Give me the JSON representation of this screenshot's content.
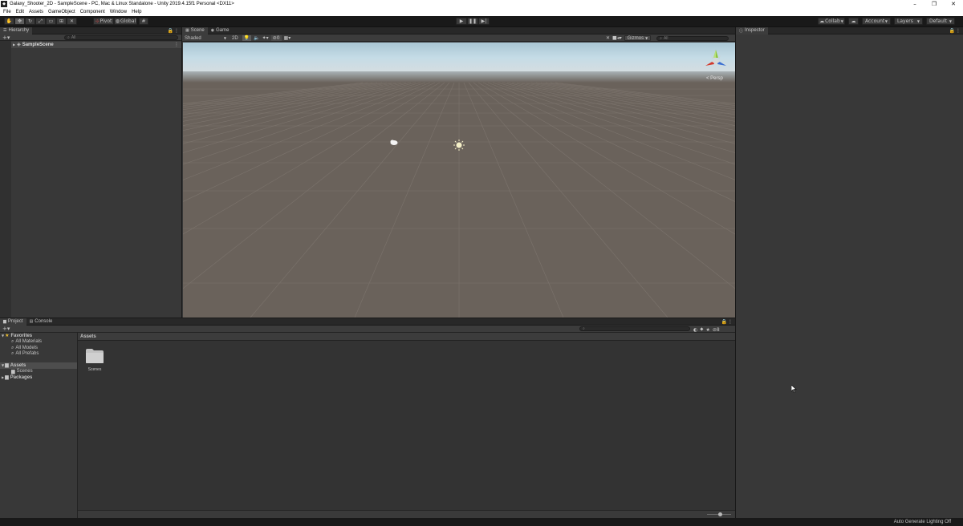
{
  "window": {
    "title": "Galaxy_Shooter_2D - SampleScene - PC, Mac & Linux Standalone - Unity 2019.4.15f1 Personal <DX11>",
    "minimize": "–",
    "restore": "❐",
    "close": "✕"
  },
  "menu": [
    "File",
    "Edit",
    "Assets",
    "GameObject",
    "Component",
    "Window",
    "Help"
  ],
  "toolbar": {
    "pivot_label": "Pivot",
    "global_label": "Global",
    "collab_label": "Collab",
    "account_label": "Account",
    "layers_label": "Layers",
    "layout_label": "Default"
  },
  "hierarchy": {
    "tab_label": "Hierarchy",
    "search_placeholder": "All",
    "scene_name": "SampleScene"
  },
  "scene_view": {
    "tabs": [
      "Scene",
      "Game"
    ],
    "shading_mode": "Shaded",
    "mode_2d_label": "2D",
    "hidden_count": "0",
    "gizmos_label": "Gizmos",
    "search_placeholder": "All",
    "projection_label": "< Persp"
  },
  "inspector": {
    "tab_label": "Inspector"
  },
  "project": {
    "tabs": [
      "Project",
      "Console"
    ],
    "favorites_label": "Favorites",
    "favorites": [
      "All Materials",
      "All Models",
      "All Prefabs"
    ],
    "assets_label": "Assets",
    "assets_children": [
      "Scenes"
    ],
    "packages_label": "Packages",
    "breadcrumb": "Assets",
    "folder_items": [
      "Scenes"
    ],
    "hidden_packages_count": "8"
  },
  "statusbar": {
    "text": "Auto Generate Lighting Off"
  },
  "colors": {
    "editor_bg": "#191919",
    "panel_bg": "#383838",
    "ground": "#6a625b",
    "sky_top": "#c5dce6",
    "gizmo_y": "#8ec63f",
    "gizmo_x": "#d2392c",
    "gizmo_z": "#3b6fd1"
  }
}
